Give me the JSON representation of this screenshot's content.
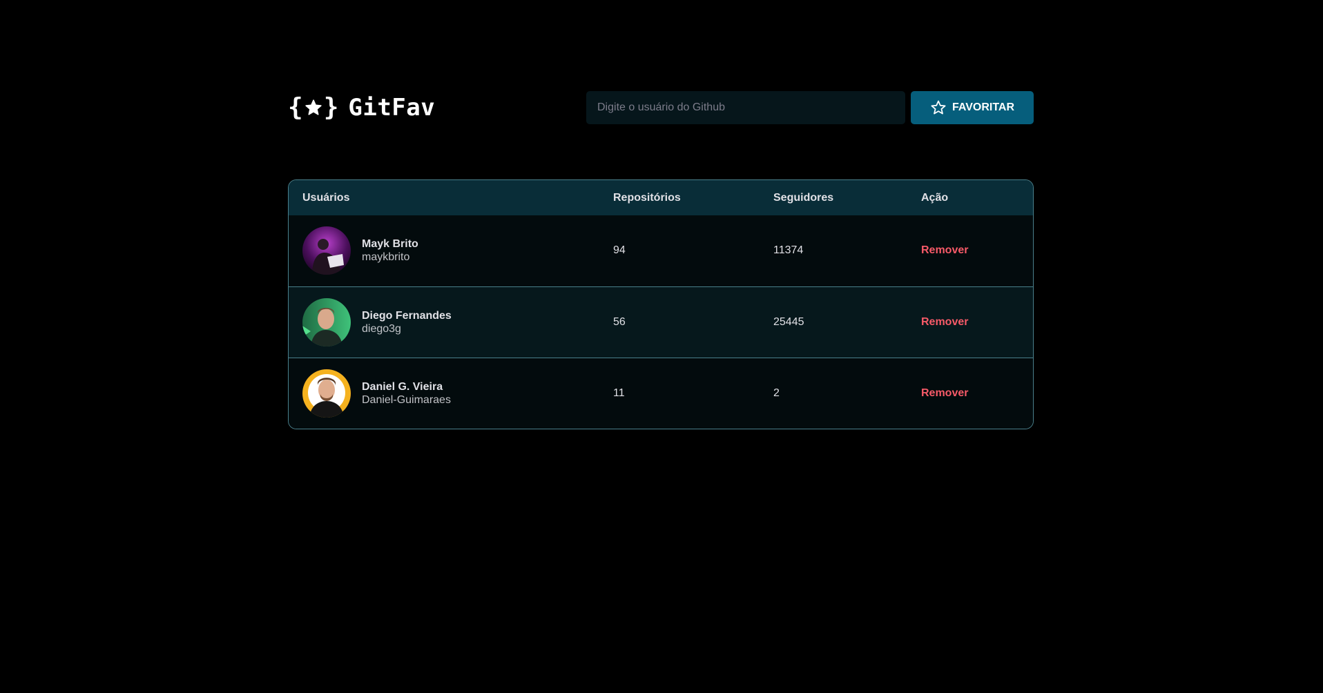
{
  "header": {
    "logo_text": "GitFav",
    "search": {
      "placeholder": "Digite o usuário do Github",
      "value": ""
    },
    "favorite_button_label": "FAVORITAR"
  },
  "table": {
    "columns": [
      "Usuários",
      "Repositórios",
      "Seguidores",
      "Ação"
    ],
    "rows": [
      {
        "name": "Mayk Brito",
        "login": "maykbrito",
        "repositories": "94",
        "followers": "11374",
        "action": "Remover"
      },
      {
        "name": "Diego Fernandes",
        "login": "diego3g",
        "repositories": "56",
        "followers": "25445",
        "action": "Remover"
      },
      {
        "name": "Daniel G. Vieira",
        "login": "Daniel-Guimaraes",
        "repositories": "11",
        "followers": "2",
        "action": "Remover"
      }
    ]
  },
  "colors": {
    "background": "#000000",
    "header_row": "#092d38",
    "button": "#065e7c",
    "remove": "#f75a68",
    "border": "#4a808c"
  },
  "icons": {
    "logo": "star-braces-icon",
    "button": "star-outline-icon"
  }
}
